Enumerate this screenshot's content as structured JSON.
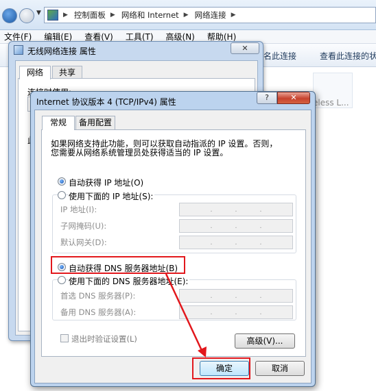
{
  "explorer": {
    "breadcrumb": [
      "控制面板",
      "网络和 Internet",
      "网络连接"
    ],
    "menu": [
      "文件(F)",
      "编辑(E)",
      "查看(V)",
      "工具(T)",
      "高级(N)",
      "帮助(H)"
    ],
    "cmd_rename": "名此连接",
    "cmd_status": "查看此连接的状",
    "adapter_text": "eless L..."
  },
  "wireless_dialog": {
    "title": "无线网络连接 属性",
    "tabs": [
      "网络",
      "共享"
    ],
    "partial_label": "连接时使用:",
    "partial_char": "此"
  },
  "ipv4_dialog": {
    "title": "Internet 协议版本 4 (TCP/IPv4) 属性",
    "help_glyph": "?",
    "close_glyph": "✕",
    "tabs": [
      "常规",
      "备用配置"
    ],
    "description": [
      "如果网络支持此功能，则可以获取自动指派的 IP 设置。否则，",
      "您需要从网络系统管理员处获得适当的 IP 设置。"
    ],
    "ip_auto_label": "自动获得 IP 地址(O)",
    "ip_manual_label": "使用下面的 IP 地址(S):",
    "ip_fields": [
      "IP 地址(I):",
      "子网掩码(U):",
      "默认网关(D):"
    ],
    "dns_auto_label": "自动获得 DNS 服务器地址(B)",
    "dns_manual_label": "使用下面的 DNS 服务器地址(E):",
    "dns_fields": [
      "首选 DNS 服务器(P):",
      "备用 DNS 服务器(A):"
    ],
    "ip_dots": [
      ".",
      ".",
      "."
    ],
    "validate_label": "退出时验证设置(L)",
    "advanced_button": "高级(V)...",
    "ok_button": "确定",
    "cancel_button": "取消",
    "ip_auto_selected": true,
    "dns_auto_selected": true,
    "validate_checked": false
  },
  "annotation_color": "#e2171c"
}
